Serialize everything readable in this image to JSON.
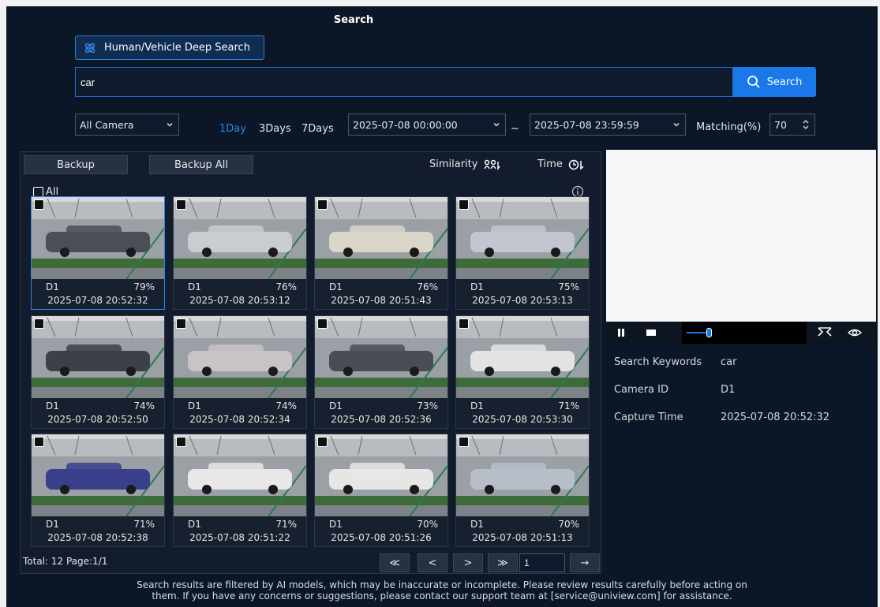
{
  "title": "Search",
  "deep_search": {
    "label": "Human/Vehicle Deep Search",
    "icon": "atom-icon"
  },
  "search": {
    "value": "car",
    "button_label": "Search"
  },
  "filters": {
    "camera": "All Camera",
    "day_ranges": [
      "1Day",
      "3Days",
      "7Days"
    ],
    "active_range": "1Day",
    "start_time": "2025-07-08 00:00:00",
    "separator": "~",
    "end_time": "2025-07-08 23:59:59",
    "matching_label": "Matching(%)",
    "matching_value": "70"
  },
  "toolbar": {
    "backup": "Backup",
    "backup_all": "Backup All",
    "similarity": "Similarity",
    "time": "Time",
    "select_all": "All"
  },
  "results": [
    {
      "camera": "D1",
      "match": "79%",
      "time": "2025-07-08 20:52:32",
      "car": "#4a4f57",
      "selected": true
    },
    {
      "camera": "D1",
      "match": "76%",
      "time": "2025-07-08 20:53:12",
      "car": "#c9cdd2",
      "selected": false
    },
    {
      "camera": "D1",
      "match": "76%",
      "time": "2025-07-08 20:51:43",
      "car": "#d9d5c8",
      "selected": false
    },
    {
      "camera": "D1",
      "match": "75%",
      "time": "2025-07-08 20:53:13",
      "car": "#c2c7cf",
      "selected": false
    },
    {
      "camera": "D1",
      "match": "74%",
      "time": "2025-07-08 20:52:50",
      "car": "#3c4048",
      "selected": false
    },
    {
      "camera": "D1",
      "match": "74%",
      "time": "2025-07-08 20:52:34",
      "car": "#c9c2c6",
      "selected": false
    },
    {
      "camera": "D1",
      "match": "73%",
      "time": "2025-07-08 20:52:36",
      "car": "#4a4d55",
      "selected": false
    },
    {
      "camera": "D1",
      "match": "71%",
      "time": "2025-07-08 20:53:30",
      "car": "#e3e3e3",
      "selected": false
    },
    {
      "camera": "D1",
      "match": "71%",
      "time": "2025-07-08 20:52:38",
      "car": "#3a3f8c",
      "selected": false
    },
    {
      "camera": "D1",
      "match": "71%",
      "time": "2025-07-08 20:51:22",
      "car": "#e8e8e8",
      "selected": false
    },
    {
      "camera": "D1",
      "match": "70%",
      "time": "2025-07-08 20:51:26",
      "car": "#e6e6e6",
      "selected": false
    },
    {
      "camera": "D1",
      "match": "70%",
      "time": "2025-07-08 20:51:13",
      "car": "#b8bec8",
      "selected": false
    }
  ],
  "pagination": {
    "total": "Total: 12  Page:1/1",
    "page_input": "1",
    "first": "≪",
    "prev": "<",
    "next": ">",
    "last": "≫",
    "go": "→"
  },
  "player": {
    "progress": 0.2
  },
  "details": {
    "keywords_label": "Search Keywords",
    "keywords": "car",
    "camera_label": "Camera ID",
    "camera": "D1",
    "capture_label": "Capture Time",
    "capture": "2025-07-08 20:52:32"
  },
  "disclaimer_line1": "Search results are filtered by AI models, which may be inaccurate or incomplete. Please review results carefully before acting on",
  "disclaimer_line2": "them. If you have any concerns or suggestions, please contact our support team at [service@uniview.com] for assistance.",
  "colors": {
    "accent": "#1b78e8",
    "background": "#0b1626",
    "panel": "#121c2c"
  }
}
